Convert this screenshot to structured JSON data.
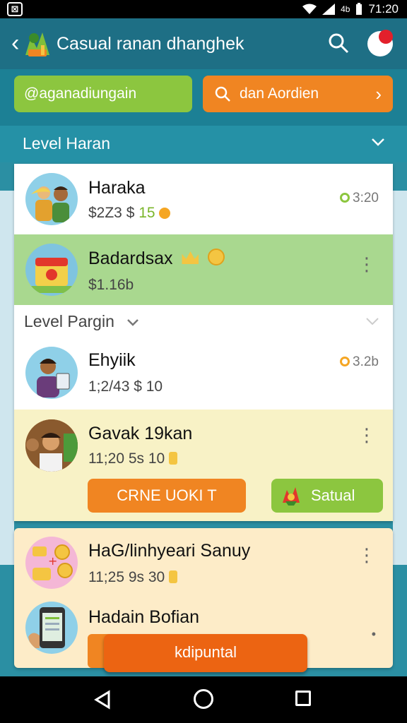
{
  "status_bar": {
    "time": "71:20",
    "signal_text": "4b"
  },
  "app_bar": {
    "title": "Casual ranan dhanghek",
    "back_glyph": "‹"
  },
  "chips": {
    "green_label": "@aganadiungain",
    "orange_label": "dan Aordien",
    "orange_chevron": "›"
  },
  "level_header": {
    "label": "Level Haran"
  },
  "rows": [
    {
      "name": "Haraka",
      "sub_left": "$2Z3 $",
      "sub_value": "15",
      "right": "3:20"
    },
    {
      "name": "Badardsax",
      "sub_left": "$1.16b"
    },
    {
      "name": "Ehyiik",
      "sub_left": "1;2/43 $",
      "sub_value": "10",
      "right": "3.2b"
    },
    {
      "name": "Gavak 19kan",
      "sub_left": "11;20 5s",
      "sub_value": "10"
    }
  ],
  "section2": {
    "label": "Level Pargin"
  },
  "buttons": {
    "orange_label": "CRNE UOKI T",
    "green_label": "Satual"
  },
  "bottom_rows": [
    {
      "name": "HaG/linhyeari Sanuy",
      "sub_left": "11;25 9s",
      "sub_value": "30"
    },
    {
      "name": "Hadain Bofian"
    }
  ],
  "fab": {
    "label": "kdipuntal"
  },
  "colors": {
    "app_bar": "#1e6f85",
    "accent_green": "#8cc63f",
    "accent_orange": "#f08522",
    "highlight_row": "#a9d88f",
    "pale_yellow": "#f8f2c6"
  },
  "icons": {
    "back": "chevron-left-icon",
    "search": "search-icon",
    "notification": "notification-icon",
    "chevron_down": "chevron-down-icon"
  }
}
